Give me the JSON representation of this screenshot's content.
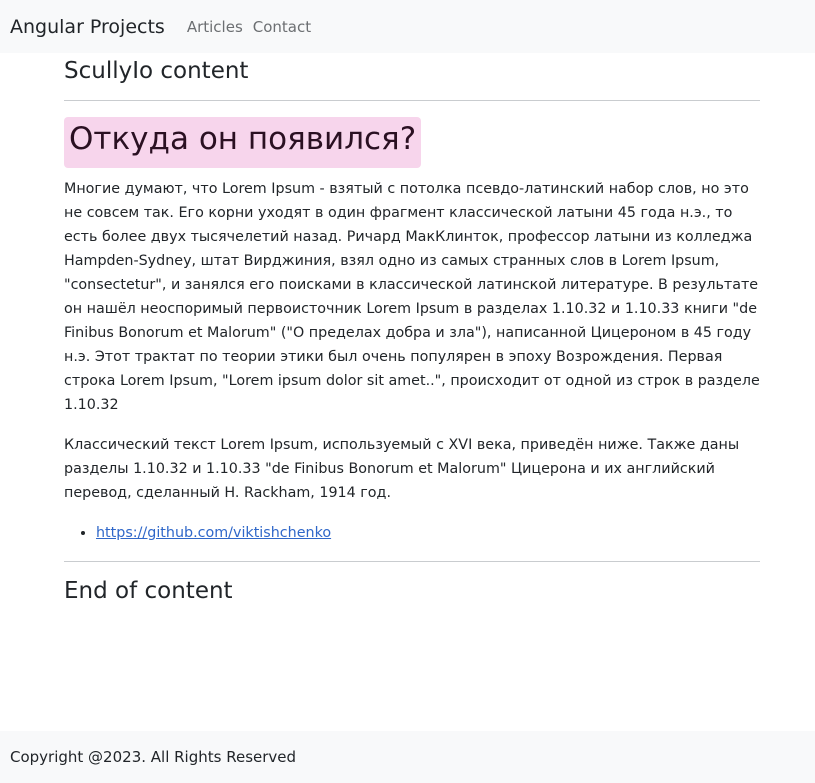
{
  "navbar": {
    "brand": "Angular Projects",
    "links": [
      "Articles",
      "Contact"
    ]
  },
  "main": {
    "section_title": "ScullyIo content",
    "heading": "Откуда он появился?",
    "paragraphs": [
      "Многие думают, что Lorem Ipsum - взятый с потолка псевдо-латинский набор слов, но это не совсем так. Его корни уходят в один фрагмент классической латыни 45 года н.э., то есть более двух тысячелетий назад. Ричард МакКлинток, профессор латыни из колледжа Hampden-Sydney, штат Вирджиния, взял одно из самых странных слов в Lorem Ipsum, \"consectetur\", и занялся его поисками в классической латинской литературе. В результате он нашёл неоспоримый первоисточник Lorem Ipsum в разделах 1.10.32 и 1.10.33 книги \"de Finibus Bonorum et Malorum\" (\"О пределах добра и зла\"), написанной Цицероном в 45 году н.э. Этот трактат по теории этики был очень популярен в эпоху Возрождения. Первая строка Lorem Ipsum, \"Lorem ipsum dolor sit amet..\", происходит от одной из строк в разделе 1.10.32",
      "Классический текст Lorem Ipsum, используемый с XVI века, приведён ниже. Также даны разделы 1.10.32 и 1.10.33 \"de Finibus Bonorum et Malorum\" Цицерона и их английский перевод, сделанный H. Rackham, 1914 год."
    ],
    "links": [
      "https://github.com/viktishchenko"
    ],
    "end_title": "End of content"
  },
  "footer": {
    "text": "Copyright @2023. All Rights Reserved"
  },
  "colors": {
    "navbar_bg": "#f8f9fa",
    "highlight_bg": "#f7d5ec",
    "link": "#2f67c9"
  }
}
